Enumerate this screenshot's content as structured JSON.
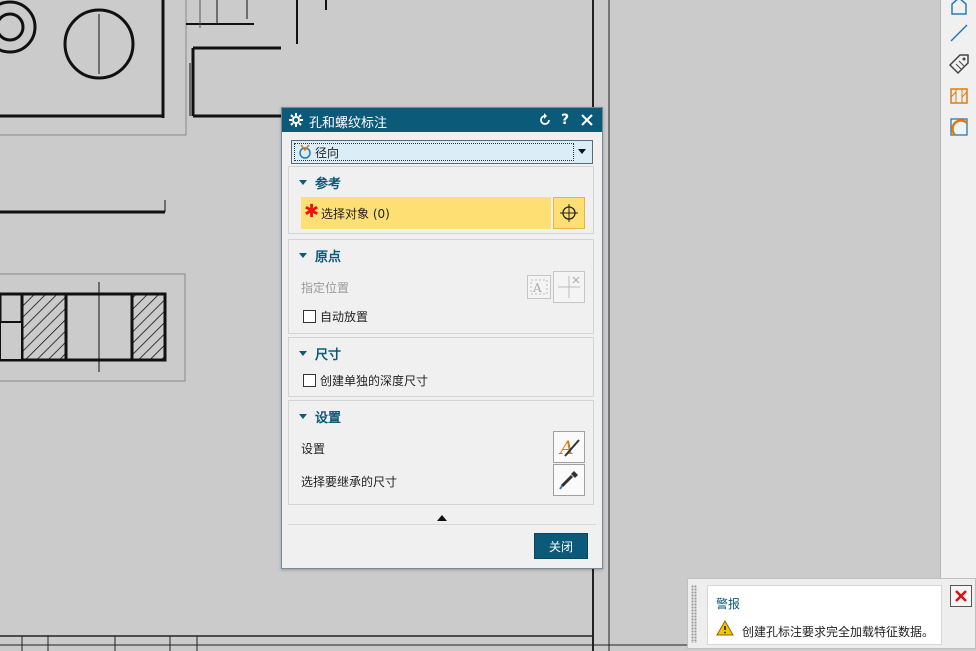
{
  "dialog": {
    "title": "孔和螺纹标注",
    "type_select": {
      "value": "径向"
    },
    "sections": {
      "reference": {
        "title": "参考",
        "select_object_label": "选择对象 (0)"
      },
      "origin": {
        "title": "原点",
        "specify_location": "指定位置",
        "auto_place": "自动放置"
      },
      "dimension": {
        "title": "尺寸",
        "create_depth": "创建单独的深度尺寸"
      },
      "settings": {
        "title": "设置",
        "settings_label": "设置",
        "inherit_label": "选择要继承的尺寸"
      }
    },
    "close_label": "关闭"
  },
  "alert": {
    "title": "警报",
    "message": "创建孔标注要求完全加载特征数据。"
  },
  "colors": {
    "titlebar": "#0b5a7a",
    "highlight": "#fddf73",
    "select_bg": "#dbeef7",
    "canvas_bg": "#cbcbcb"
  },
  "icons": {
    "title": "gear-icon",
    "reset": "reset-icon",
    "help": "help-icon",
    "close": "close-icon",
    "required": "asterisk-icon",
    "crosshair": "crosshair-icon",
    "warning": "warning-icon"
  }
}
